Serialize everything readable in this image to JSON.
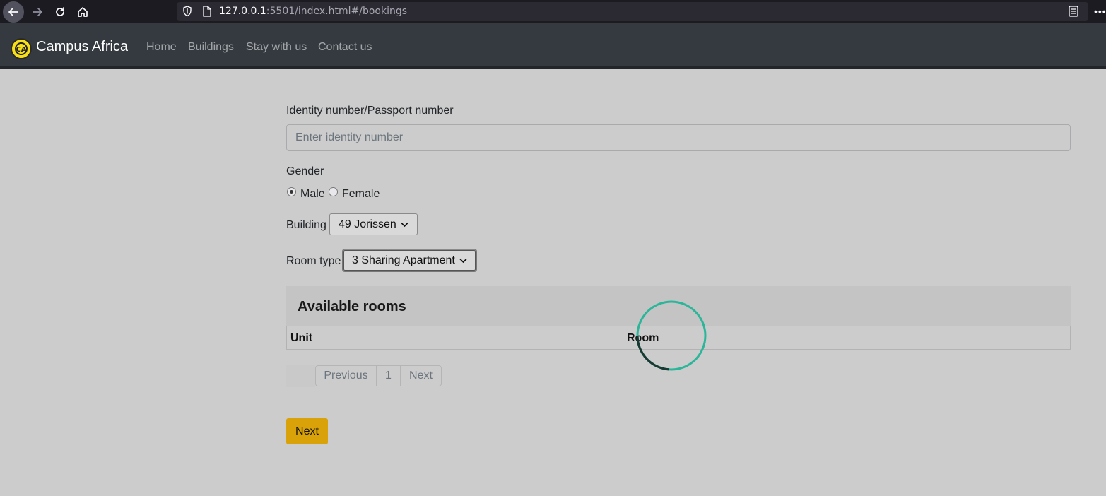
{
  "browser": {
    "url_host": "127.0.0.1",
    "url_rest": ":5501/index.html#/bookings"
  },
  "navbar": {
    "brand": "Campus Africa",
    "links": [
      "Home",
      "Buildings",
      "Stay with us",
      "Contact us"
    ]
  },
  "form": {
    "identity_label": "Identity number/Passport number",
    "identity_placeholder": "Enter identity number",
    "identity_value": "",
    "gender_label": "Gender",
    "gender_options": [
      {
        "label": "Male",
        "checked": true
      },
      {
        "label": "Female",
        "checked": false
      }
    ],
    "building_label": "Building",
    "building_value": "49 Jorissen",
    "room_type_label": "Room type",
    "room_type_value": "3 Sharing Apartment"
  },
  "rooms": {
    "title": "Available rooms",
    "columns": [
      "Unit",
      "Room"
    ],
    "rows": []
  },
  "pagination": {
    "previous": "Previous",
    "page": "1",
    "next": "Next"
  },
  "submit_label": "Next",
  "colors": {
    "navbar": "#343a40",
    "page_bg": "#cccccc",
    "accent": "#d8a208",
    "spinner": "#2bb69a"
  },
  "icons": [
    "back-icon",
    "forward-icon",
    "reload-icon",
    "home-icon",
    "shield-icon",
    "page-icon",
    "reader-icon",
    "overflow-icon",
    "chevron-down-icon",
    "loading-spinner"
  ]
}
